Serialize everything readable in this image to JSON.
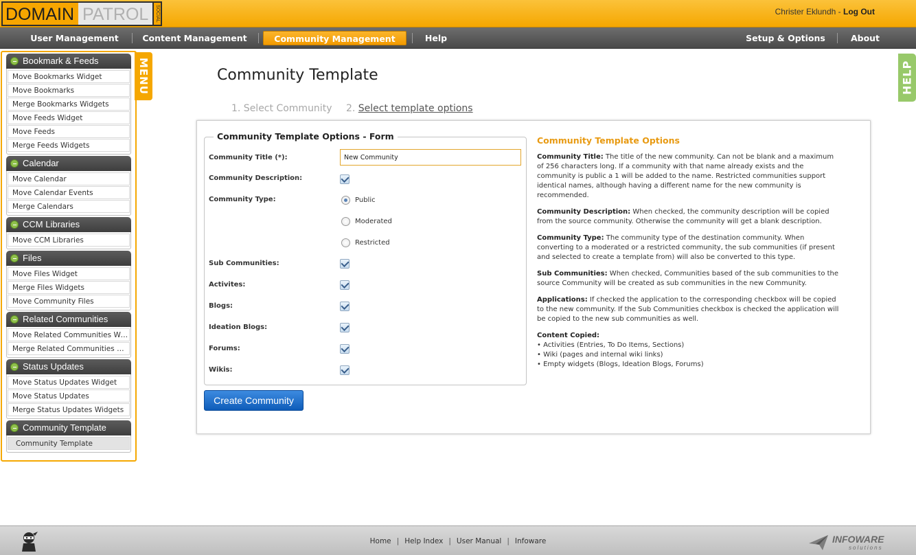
{
  "header": {
    "logo_domain": "DOMAIN",
    "logo_patrol": "PATROL",
    "logo_social": "SOCIAL",
    "user_name": "Christer Eklundh",
    "separator": "-",
    "logout_label": "Log Out"
  },
  "nav": {
    "user_management": "User Management",
    "content_management": "Content Management",
    "community_management": "Community Management",
    "help": "Help",
    "setup_options": "Setup & Options",
    "about": "About"
  },
  "side_tabs": {
    "menu": "MENU",
    "help": "HELP"
  },
  "sidebar": {
    "groups": [
      {
        "title": "Bookmark & Feeds",
        "items": [
          "Move Bookmarks Widget",
          "Move Bookmarks",
          "Merge Bookmarks Widgets",
          "Move Feeds Widget",
          "Move Feeds",
          "Merge Feeds Widgets"
        ]
      },
      {
        "title": "Calendar",
        "items": [
          "Move Calendar",
          "Move Calendar Events",
          "Merge Calendars"
        ]
      },
      {
        "title": "CCM Libraries",
        "items": [
          "Move CCM Libraries"
        ]
      },
      {
        "title": "Files",
        "items": [
          "Move Files Widget",
          "Merge Files Widgets",
          "Move Community Files"
        ]
      },
      {
        "title": "Related Communities",
        "items": [
          "Move Related Communities Wid...",
          "Merge Related Communities Wi..."
        ]
      },
      {
        "title": "Status Updates",
        "items": [
          "Move Status Updates Widget",
          "Move Status Updates",
          "Merge Status Updates Widgets"
        ]
      },
      {
        "title": "Community Template",
        "items": [
          "Community Template"
        ]
      }
    ]
  },
  "main": {
    "title": "Community Template",
    "steps": {
      "step1": "1. Select Community",
      "step2_num": "2.",
      "step2_label": "Select template options"
    }
  },
  "form": {
    "legend": "Community Template Options - Form",
    "title_label": "Community Title (*):",
    "title_value": "New Community",
    "description_label": "Community Description:",
    "type_label": "Community Type:",
    "type_options": [
      "Public",
      "Moderated",
      "Restricted"
    ],
    "type_selected": "Public",
    "sub_communities_label": "Sub Communities:",
    "activities_label": "Activites:",
    "blogs_label": "Blogs:",
    "ideation_blogs_label": "Ideation Blogs:",
    "forums_label": "Forums:",
    "wikis_label": "Wikis:",
    "create_button": "Create Community"
  },
  "options": {
    "title": "Community Template Options",
    "paragraphs": [
      {
        "term": "Community Title:",
        "text": " The title of the new community. Can not be blank and a maximum of 256 characters long. If a community with that name already exists and the community is public a 1 will be added to the name. Restricted communities support identical names, although having a different name for the new community is recommended."
      },
      {
        "term": "Community Description:",
        "text": " When checked, the community description will be copied from the source community. Otherwise the community will get a blank description."
      },
      {
        "term": "Community Type:",
        "text": " The community type of the destination community. When converting to a moderated or a restricted community, the sub communities (if present and selected to create a template from) will also be converted to this type."
      },
      {
        "term": "Sub Communities:",
        "text": " When checked, Communities based of the sub communities to the source Community will be created as sub communities in the new Community."
      },
      {
        "term": "Applications:",
        "text": " If checked the application to the corresponding checkbox will be copied to the new community. If the Sub Communities checkbox is checked the application will be copied to the new sub communities as well."
      }
    ],
    "content_copied_label": "Content Copied:",
    "content_copied": [
      "Activities (Entries, To Do Items, Sections)",
      "Wiki (pages and internal wiki links)",
      "Empty widgets (Blogs, Ideation Blogs, Forums)"
    ]
  },
  "footer": {
    "home": "Home",
    "help_index": "Help Index",
    "user_manual": "User Manual",
    "infoware": "Infoware",
    "sep": "|",
    "brand": "INFOWARE",
    "brand_sub": "solutions"
  }
}
